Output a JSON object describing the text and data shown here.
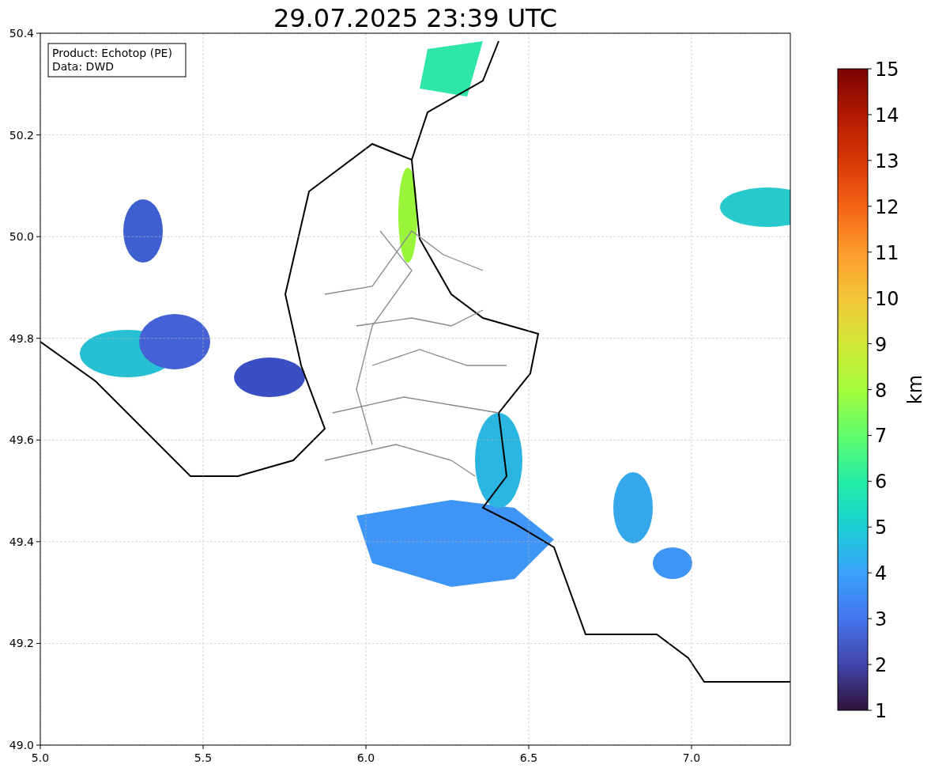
{
  "title": "29.07.2025 23:39 UTC",
  "legend": [
    "Product: Echotop (PE)",
    "Data: DWD"
  ],
  "x_axis": {
    "ticks": [
      "5.0",
      "5.5",
      "6.0",
      "6.5",
      "7.0"
    ]
  },
  "y_axis": {
    "ticks": [
      "50.4",
      "50.2",
      "50.0",
      "49.8",
      "49.6",
      "49.4",
      "49.2",
      "49.0"
    ]
  },
  "colorbar": {
    "label": "km",
    "ticks": [
      "15",
      "14",
      "13",
      "12",
      "11",
      "10",
      "9",
      "8",
      "7",
      "6",
      "5",
      "4",
      "3",
      "2",
      "1"
    ]
  }
}
